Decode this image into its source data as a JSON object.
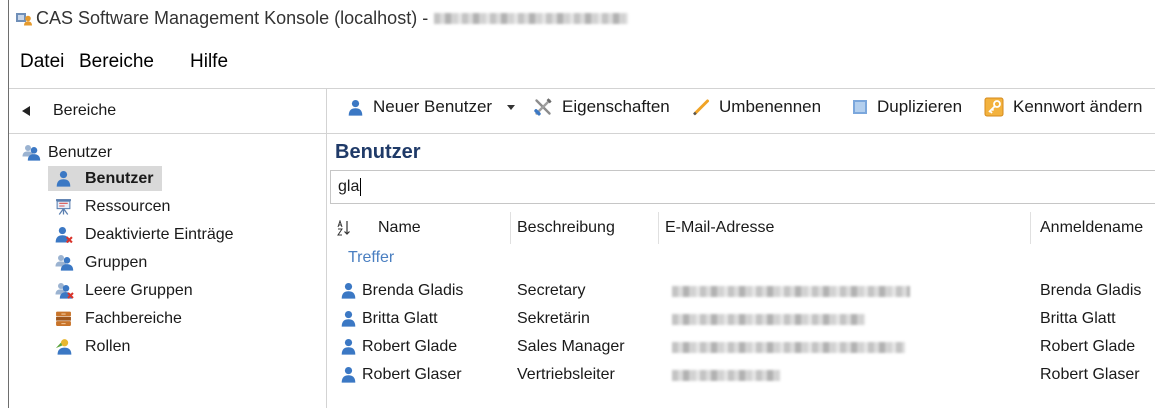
{
  "window": {
    "title": "CAS Software Management Konsole (localhost) -",
    "app_icon": "cas-app-icon"
  },
  "menu": {
    "items": [
      {
        "label": "Datei"
      },
      {
        "label": "Bereiche"
      },
      {
        "label": "Hilfe"
      }
    ]
  },
  "nav": {
    "header_label": "Bereiche",
    "header_icon": "collapse-left-icon",
    "root": {
      "label": "Benutzer",
      "icon": "users-icon"
    },
    "items": [
      {
        "label": "Benutzer",
        "icon": "user-icon",
        "selected": true
      },
      {
        "label": "Ressourcen",
        "icon": "resource-board-icon",
        "selected": false
      },
      {
        "label": "Deaktivierte Einträge",
        "icon": "user-disabled-icon",
        "selected": false
      },
      {
        "label": "Gruppen",
        "icon": "group-icon",
        "selected": false
      },
      {
        "label": "Leere Gruppen",
        "icon": "empty-group-icon",
        "selected": false
      },
      {
        "label": "Fachbereiche",
        "icon": "department-icon",
        "selected": false
      },
      {
        "label": "Rollen",
        "icon": "role-icon",
        "selected": false
      }
    ]
  },
  "toolbar": {
    "new_user": {
      "label": "Neuer Benutzer",
      "icon": "new-user-icon",
      "has_dropdown": true
    },
    "properties": {
      "label": "Eigenschaften",
      "icon": "tools-icon"
    },
    "rename": {
      "label": "Umbenennen",
      "icon": "pencil-icon"
    },
    "duplicate": {
      "label": "Duplizieren",
      "icon": "duplicate-icon"
    },
    "change_password": {
      "label": "Kennwort ändern",
      "icon": "key-icon"
    }
  },
  "main": {
    "title": "Benutzer",
    "search": {
      "value": "gla"
    },
    "sort_icon": "sort-az-icon",
    "columns": [
      {
        "label": "Name"
      },
      {
        "label": "Beschreibung"
      },
      {
        "label": "E-Mail-Adresse"
      },
      {
        "label": "Anmeldename"
      }
    ],
    "group_label": "Treffer",
    "rows": [
      {
        "name": "Brenda Gladis",
        "description": "Secretary",
        "login": "Brenda Gladis",
        "icon": "user-icon"
      },
      {
        "name": "Britta Glatt",
        "description": "Sekretärin",
        "login": "Britta Glatt",
        "icon": "user-icon"
      },
      {
        "name": "Robert Glade",
        "description": "Sales Manager",
        "login": "Robert Glade",
        "icon": "user-icon"
      },
      {
        "name": "Robert Glaser",
        "description": "Vertriebsleiter",
        "login": "Robert Glaser",
        "icon": "user-icon"
      }
    ]
  },
  "colors": {
    "accent": "#3b78c4",
    "heading": "#1f3a68",
    "group_label": "#4a7fc1",
    "selection": "#d9d9d9"
  }
}
